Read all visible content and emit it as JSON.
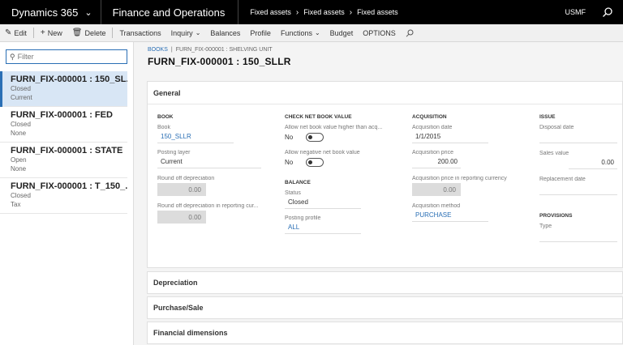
{
  "topbar": {
    "app_title": "Dynamics 365",
    "module": "Finance and Operations",
    "breadcrumbs": [
      "Fixed assets",
      "Fixed assets",
      "Fixed assets"
    ],
    "company": "USMF"
  },
  "actions": {
    "edit": "Edit",
    "new": "New",
    "delete": "Delete",
    "transactions": "Transactions",
    "inquiry": "Inquiry",
    "balances": "Balances",
    "profile": "Profile",
    "functions": "Functions",
    "budget": "Budget",
    "options": "OPTIONS"
  },
  "filter": {
    "placeholder": "Filter"
  },
  "list": [
    {
      "title": "FURN_FIX-000001 : 150_SL...",
      "line1": "Closed",
      "line2": "Current"
    },
    {
      "title": "FURN_FIX-000001 : FED",
      "line1": "Closed",
      "line2": "None"
    },
    {
      "title": "FURN_FIX-000001 : STATE",
      "line1": "Open",
      "line2": "None"
    },
    {
      "title": "FURN_FIX-000001 : T_150_...",
      "line1": "Closed",
      "line2": "Tax"
    }
  ],
  "header": {
    "crumb_link": "BOOKS",
    "crumb_text": "FURN_FIX-000001 : SHELVING UNIT",
    "title": "FURN_FIX-000001 : 150_SLLR"
  },
  "general": {
    "tab_label": "General",
    "book": {
      "group": "BOOK",
      "book_label": "Book",
      "book_value": "150_SLLR",
      "posting_layer_label": "Posting layer",
      "posting_layer_value": "Current",
      "round_off_label": "Round off depreciation",
      "round_off_value": "0.00",
      "round_off_rc_label": "Round off depreciation in reporting cur...",
      "round_off_rc_value": "0.00"
    },
    "nbv": {
      "group": "CHECK NET BOOK VALUE",
      "higher_label": "Allow net book value higher than acq...",
      "higher_value": "No",
      "negative_label": "Allow negative net book value",
      "negative_value": "No"
    },
    "balance": {
      "group": "BALANCE",
      "status_label": "Status",
      "status_value": "Closed",
      "profile_label": "Posting profile",
      "profile_value": "ALL"
    },
    "acquisition": {
      "group": "ACQUISITION",
      "date_label": "Acquisition date",
      "date_value": "1/1/2015",
      "price_label": "Acquisition price",
      "price_value": "200.00",
      "price_rc_label": "Acquisition price in reporting currency",
      "price_rc_value": "0.00",
      "method_label": "Acquisition method",
      "method_value": "PURCHASE"
    },
    "issue": {
      "group": "ISSUE",
      "disposal_label": "Disposal date",
      "disposal_value": "",
      "sales_label": "Sales value",
      "sales_value": "0.00",
      "replacement_label": "Replacement date",
      "replacement_value": ""
    },
    "provisions": {
      "group": "PROVISIONS",
      "type_label": "Type",
      "type_value": ""
    }
  },
  "fasttabs": [
    "Depreciation",
    "Purchase/Sale",
    "Financial dimensions"
  ]
}
